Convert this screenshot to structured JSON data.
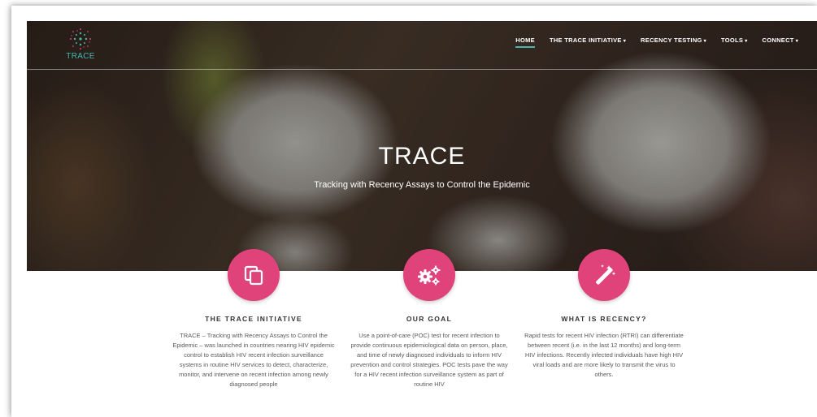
{
  "brand": {
    "name": "TRACE",
    "accent": "#47b6b1",
    "feature_color": "#e0437a"
  },
  "nav": {
    "items": [
      {
        "label": "HOME",
        "active": true,
        "dropdown": false
      },
      {
        "label": "THE TRACE INITIATIVE",
        "active": false,
        "dropdown": true
      },
      {
        "label": "RECENCY TESTING",
        "active": false,
        "dropdown": true
      },
      {
        "label": "TOOLS",
        "active": false,
        "dropdown": true
      },
      {
        "label": "CONNECT",
        "active": false,
        "dropdown": true
      }
    ]
  },
  "hero": {
    "title": "TRACE",
    "subtitle": "Tracking with Recency Assays to Control the Epidemic"
  },
  "features": [
    {
      "icon": "copy-icon",
      "title": "THE TRACE INITIATIVE",
      "text": "TRACE – Tracking with Recency Assays to Control the Epidemic – was launched in countries nearing HIV epidemic control to establish HIV recent infection surveillance systems in routine HIV services to detect, characterize, monitor, and intervene on recent infection among newly diagnosed people"
    },
    {
      "icon": "gears-icon",
      "title": "OUR GOAL",
      "text": "Use a point-of-care (POC) test for recent infection to provide continuous epidemiological data on person, place, and time of newly diagnosed individuals to inform HIV prevention and control strategies. POC tests pave the way for a HIV recent infection surveillance system as part of routine HIV"
    },
    {
      "icon": "magic-wand-icon",
      "title": "WHAT IS RECENCY?",
      "text": "Rapid tests for recent HIV infection (RTRI) can differentiate between recent (i.e. in the last 12 months) and long-term HIV infections. Recently infected individuals have high HIV viral loads and are more likely to transmit the virus to others."
    }
  ]
}
